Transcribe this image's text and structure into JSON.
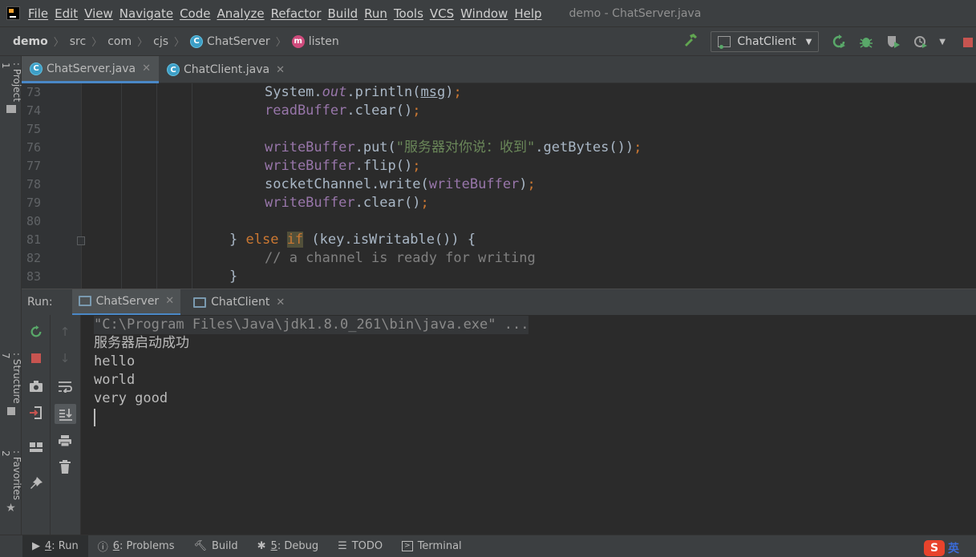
{
  "menubar": {
    "items": [
      {
        "id": "file",
        "label": "File"
      },
      {
        "id": "edit",
        "label": "Edit"
      },
      {
        "id": "view",
        "label": "View"
      },
      {
        "id": "navigate",
        "label": "Navigate"
      },
      {
        "id": "code",
        "label": "Code"
      },
      {
        "id": "analyze",
        "label": "Analyze"
      },
      {
        "id": "refactor",
        "label": "Refactor"
      },
      {
        "id": "build",
        "label": "Build"
      },
      {
        "id": "run",
        "label": "Run"
      },
      {
        "id": "tools",
        "label": "Tools"
      },
      {
        "id": "vcs",
        "label": "VCS"
      },
      {
        "id": "window",
        "label": "Window"
      },
      {
        "id": "help",
        "label": "Help"
      }
    ],
    "window_title": "demo - ChatServer.java"
  },
  "breadcrumb": {
    "project": "demo",
    "src": "src",
    "pkg1": "com",
    "pkg2": "cjs",
    "class_icon": "C",
    "class": "ChatServer",
    "method_icon": "m",
    "method": "listen"
  },
  "toolbar": {
    "run_config": "ChatClient"
  },
  "left_strip": {
    "project_num": "1",
    "project_label": ": Project",
    "structure_num": "7",
    "structure_label": ": Structure",
    "favorites_num": "2",
    "favorites_label": ": Favorites"
  },
  "editor_tabs": [
    {
      "label": "ChatServer.java",
      "icon": "C"
    },
    {
      "label": "ChatClient.java",
      "icon": "C"
    }
  ],
  "editor": {
    "line_numbers": [
      "73",
      "74",
      "75",
      "76",
      "77",
      "78",
      "79",
      "80",
      "81",
      "82",
      "83"
    ],
    "code": {
      "l73_a": "System.",
      "l73_b": "out",
      "l73_c": ".println(",
      "l73_d": "msg",
      "l73_e": ")",
      "l73_f": ";",
      "l74_a": "readBuffer",
      "l74_b": ".clear()",
      "l74_c": ";",
      "l76_a": "writeBuffer",
      "l76_b": ".put(",
      "l76_c": "\"服务器对你说：收到\"",
      "l76_d": ".getBytes())",
      "l76_e": ";",
      "l77_a": "writeBuffer",
      "l77_b": ".flip()",
      "l77_c": ";",
      "l78_a": "socketChannel.write(",
      "l78_b": "writeBuffer",
      "l78_c": ")",
      "l78_d": ";",
      "l79_a": "writeBuffer",
      "l79_b": ".clear()",
      "l79_c": ";",
      "l81_a": "} ",
      "l81_b": "else",
      "l81_c": " ",
      "l81_d": "if",
      "l81_e": " (key.isWritable()) {",
      "l82": "// a channel is ready for writing",
      "l83": "}"
    }
  },
  "run_panel": {
    "label": "Run:",
    "tabs": [
      {
        "label": "ChatServer"
      },
      {
        "label": "ChatClient"
      }
    ],
    "console": [
      "\"C:\\Program Files\\Java\\jdk1.8.0_261\\bin\\java.exe\" ...",
      "服务器启动成功",
      "hello",
      "world",
      "very good"
    ]
  },
  "statusbar": {
    "run_num": "4",
    "run_label": ": Run",
    "problems_num": "6",
    "problems_label": ": Problems",
    "build_label": "Build",
    "debug_num": "5",
    "debug_label": ": Debug",
    "todo_label": "TODO",
    "terminal_label": "Terminal"
  },
  "ime": {
    "logo": "S",
    "text": "英"
  }
}
